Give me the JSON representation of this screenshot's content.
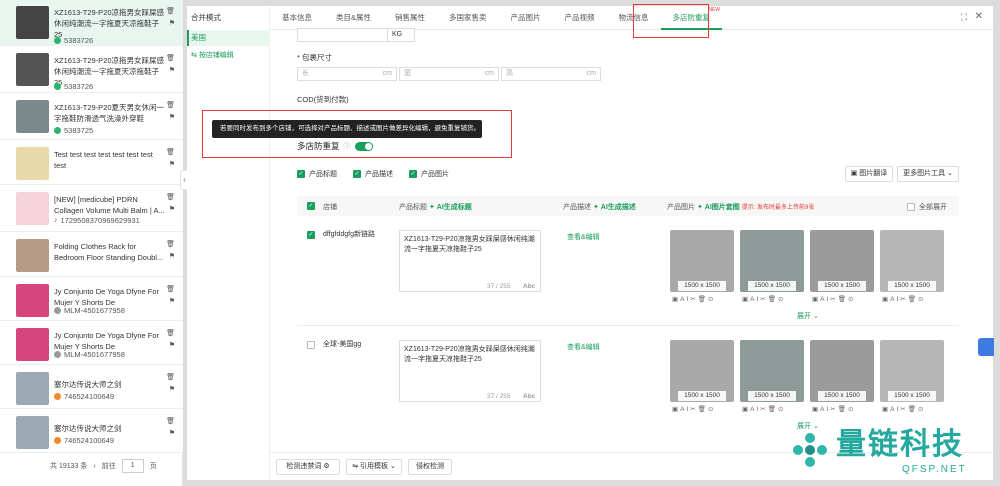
{
  "products": [
    {
      "title": "XZ1613-T29-P20凉拖男女踩屎感休闲纯潮流一字拖夏天凉拖鞋子25",
      "sku": "5383726",
      "badge": "green"
    },
    {
      "title": "XZ1613-T29-P20凉拖男女踩屎感休闲纯潮流一字拖夏天凉拖鞋子25",
      "sku": "5383726",
      "badge": "green"
    },
    {
      "title": "XZ1613-T29-P20夏天男女休闲一字拖鞋防滑透气洗澡外穿鞋",
      "sku": "5383725",
      "badge": "green"
    },
    {
      "title": "Test test test test test test test test",
      "sku": "",
      "badge": ""
    },
    {
      "title": "[NEW] [medicube] PDRN Collagen Volume Multi Balm | A...",
      "sku": "1729508370969629931",
      "badge": "tiktok"
    },
    {
      "title": "Folding Clothes Rack for Bedroom Floor Standing Doubl...",
      "sku": "",
      "badge": ""
    },
    {
      "title": "Jy Conjunto De Yoga Dfyne For Mujer Y Shorts De",
      "sku": "MLM-4501677958",
      "badge": "ml"
    },
    {
      "title": "Jy Conjunto De Yoga Dfyne For Mujer Y Shorts De",
      "sku": "MLM-4501677958",
      "badge": "ml"
    },
    {
      "title": "塞尔达传说大师之剑",
      "sku": "746524100649",
      "badge": "orange"
    },
    {
      "title": "塞尔达传说大师之剑",
      "sku": "746524100649",
      "badge": "orange"
    }
  ],
  "pager": {
    "total": "共 19133 条",
    "goto": "前往",
    "page": "1",
    "unit": "页"
  },
  "modal_side": {
    "item1": "合并模式",
    "item2": "美国",
    "item3": "按店铺编辑"
  },
  "tabs": [
    "基本信息",
    "类目&属性",
    "销售属性",
    "多国家售卖",
    "产品图片",
    "产品视频",
    "物流信息",
    "多店防重复"
  ],
  "new_badge": "NEW",
  "form": {
    "kg_unit": "KG",
    "pkg_label": "* 包裹尺寸",
    "len": "长",
    "wid": "宽",
    "hgt": "高",
    "cm": "cm",
    "cod": "COD(货到付款)",
    "tooltip": "若要同时发布到多个店铺，可选择对产品标题、描述或图片做差异化编辑，避免重复铺货。",
    "dup_label": "多店防重复",
    "opt_title": "产品标题",
    "opt_desc": "产品描述",
    "opt_img": "产品图片",
    "translate": "图片翻译",
    "more_tools": "更多图片工具"
  },
  "table": {
    "col_store": "店铺",
    "col_title": "产品标题",
    "ai_title": "AI生成标题",
    "col_desc": "产品描述",
    "ai_desc": "AI生成描述",
    "col_img": "产品图片",
    "ai_img": "AI图片套图",
    "hint": "提示: 发布时最多上传前9张",
    "expand_all": "全部展开",
    "expand": "展开",
    "view_edit": "查看&编辑",
    "img_size": "1500 x 1500",
    "abc": "Abc"
  },
  "rows": [
    {
      "store": "dffgfddgfg新链路",
      "title": "XZ1613-T29-P20凉拖男女踩屎感休闲纯潮流一字拖夏天凉拖鞋子25",
      "count": "37 / 255",
      "checked": true
    },
    {
      "store": "全球-美国gg",
      "title": "XZ1613-T29-P20凉拖男女踩屎感休闲纯潮流一字拖夏天凉拖鞋子25",
      "count": "37 / 255",
      "checked": false
    }
  ],
  "bottom": {
    "detect": "检测违禁词",
    "template": "引用模板",
    "infringe": "侵权检测"
  },
  "logo": {
    "cn": "量链科技",
    "en": "QFSP.NET"
  }
}
